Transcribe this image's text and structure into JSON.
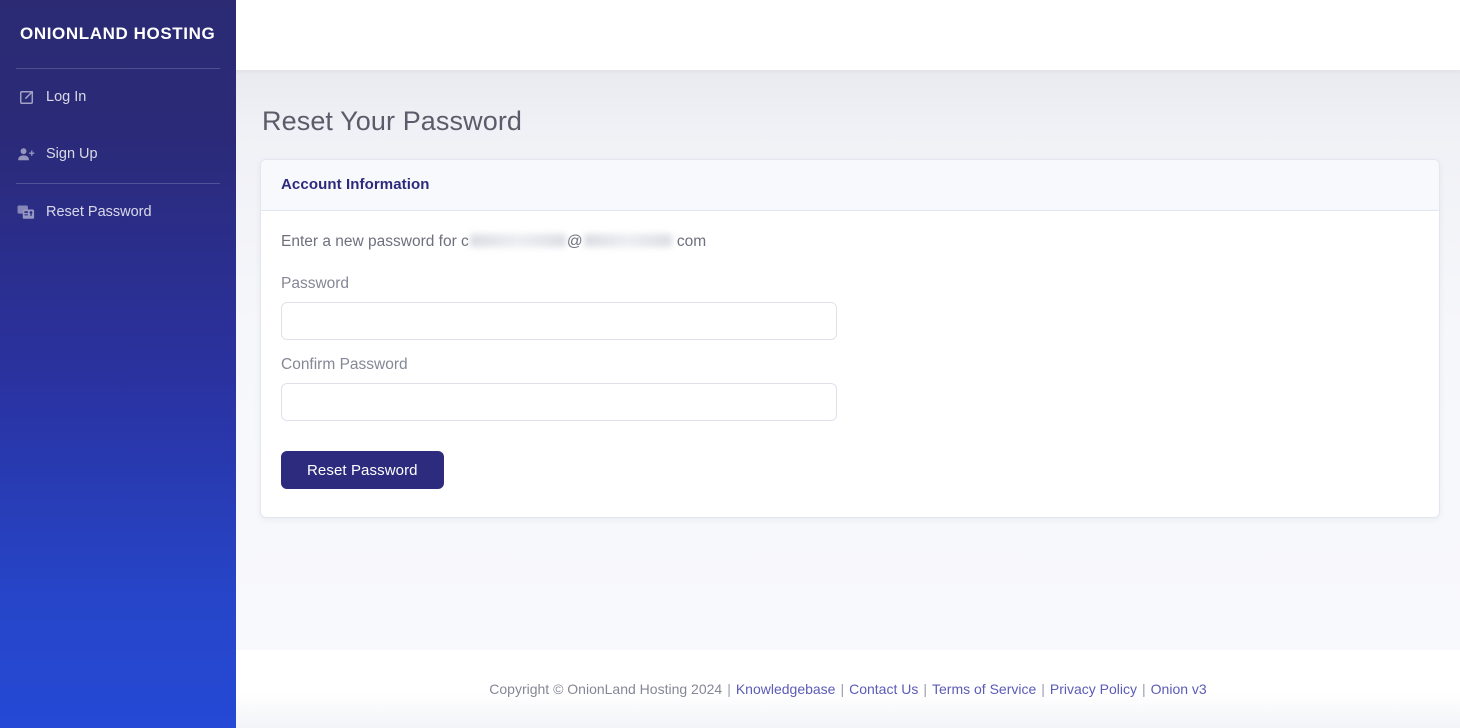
{
  "brand": {
    "name": "ONIONLAND HOSTING"
  },
  "sidebar": {
    "items": [
      {
        "label": "Log In",
        "icon": "sign-in-icon"
      },
      {
        "label": "Sign Up",
        "icon": "user-plus-icon"
      },
      {
        "label": "Reset Password",
        "icon": "id-card-icon"
      }
    ]
  },
  "page": {
    "title": "Reset Your Password"
  },
  "card": {
    "header_title": "Account Information",
    "lead_prefix": "Enter a new password for c",
    "lead_at": "@",
    "lead_suffix": " com",
    "password": {
      "label": "Password",
      "value": "",
      "placeholder": ""
    },
    "confirm_password": {
      "label": "Confirm Password",
      "value": "",
      "placeholder": ""
    },
    "submit_label": "Reset Password"
  },
  "footer": {
    "copyright": "Copyright © OnionLand Hosting 2024",
    "separator": "|",
    "links": [
      {
        "label": "Knowledgebase"
      },
      {
        "label": "Contact Us"
      },
      {
        "label": "Terms of Service"
      },
      {
        "label": "Privacy Policy"
      },
      {
        "label": "Onion v3"
      }
    ]
  },
  "colors": {
    "sidebar_top": "#2b2a73",
    "sidebar_bottom": "#2549d6",
    "accent": "#2d2b7e",
    "heading": "#5a5c69",
    "muted": "#858796",
    "link": "#5b5bb8",
    "card_header_bg": "#f8f9fc",
    "border": "#e3e6f0"
  }
}
